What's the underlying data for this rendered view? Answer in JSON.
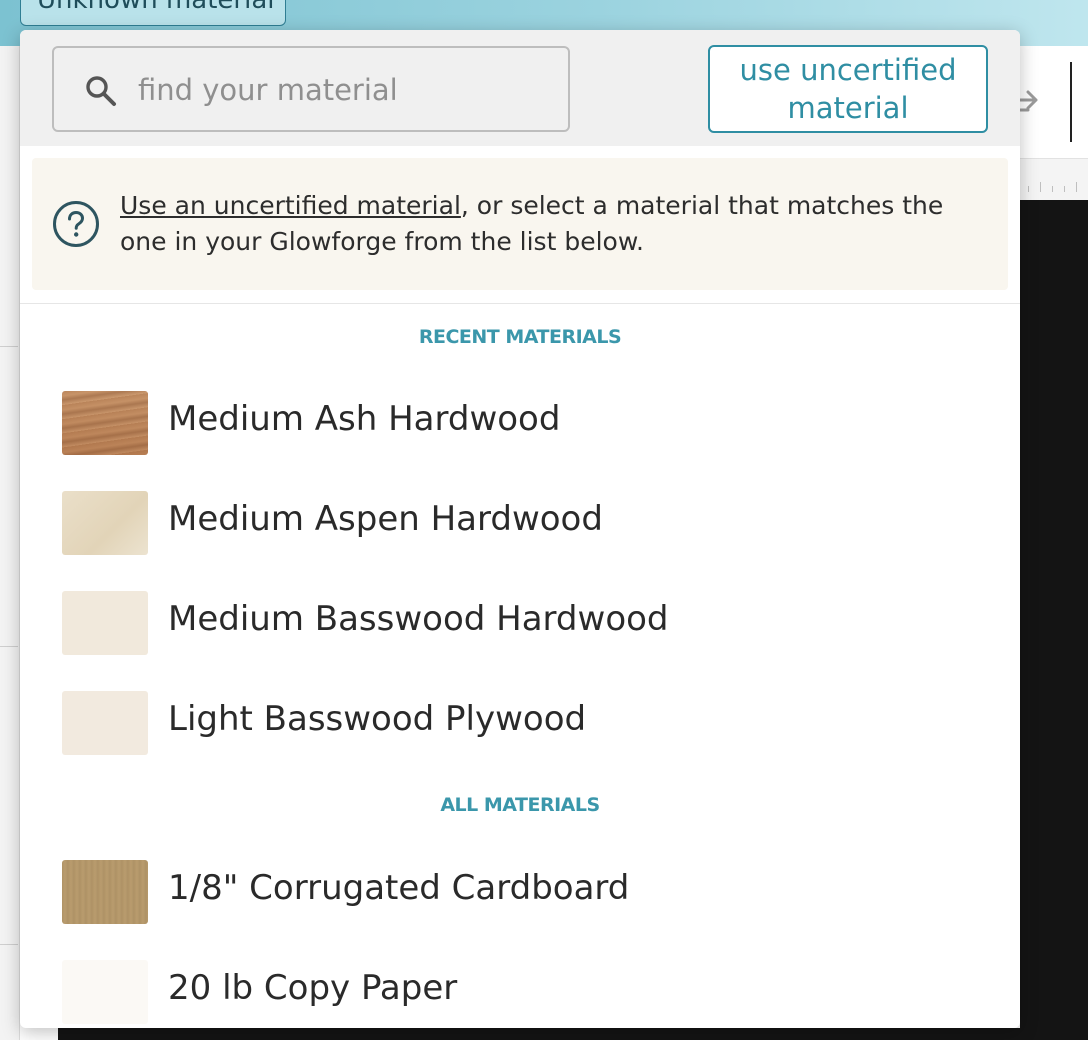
{
  "background": {
    "material_chip_label": "Unknown material"
  },
  "popup": {
    "search": {
      "placeholder": "find your material",
      "value": ""
    },
    "uncertified_button_label": "use uncertified material",
    "info": {
      "link_text": "Use an uncertified material",
      "text": ", or select a material that matches the one in your Glowforge from the list below."
    },
    "recent_header": "RECENT MATERIALS",
    "recent_materials": [
      {
        "label": "Medium Ash Hardwood",
        "swatch": "ash-wood-texture"
      },
      {
        "label": "Medium Aspen Hardwood",
        "swatch": "aspen-wood-texture"
      },
      {
        "label": "Medium Basswood Hardwood",
        "swatch": "basswood-texture"
      },
      {
        "label": "Light Basswood Plywood",
        "swatch": "basswood-plywood-texture"
      }
    ],
    "all_header": "ALL MATERIALS",
    "all_materials": [
      {
        "label": "1/8\" Corrugated Cardboard",
        "swatch": "cardboard-texture"
      },
      {
        "label": "20 lb Copy Paper",
        "swatch": "paper-texture"
      }
    ]
  },
  "colors": {
    "accent": "#2f8ea3",
    "section_header": "#3b97ab",
    "info_background": "#f9f6ef",
    "header_background": "#f0f0f0"
  }
}
